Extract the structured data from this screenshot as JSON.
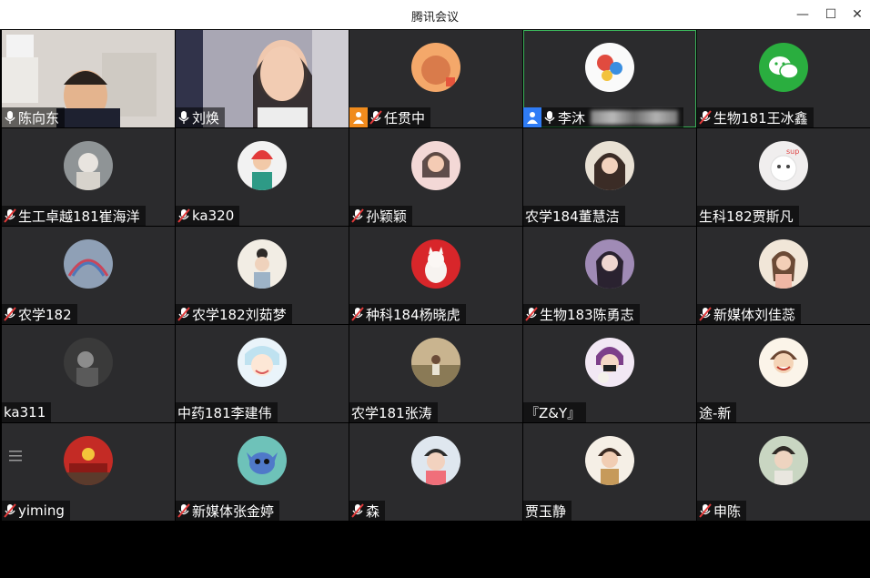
{
  "window": {
    "title": "腾讯会议",
    "minimize": "—",
    "maximize": "☐",
    "close": "✕"
  },
  "colors": {
    "tile_bg": "#2b2b2d",
    "active_border": "#3bb35a",
    "host_orange": "#f08b1d",
    "cohost_blue": "#2f7cf6"
  },
  "participants": [
    {
      "name": "陈向东",
      "mic": "on",
      "type": "video"
    },
    {
      "name": "刘焕",
      "mic": "on",
      "type": "video"
    },
    {
      "name": "任贯中",
      "mic": "muted",
      "type": "avatar",
      "role": "host"
    },
    {
      "name": "李沐",
      "mic": "on",
      "type": "avatar",
      "role": "cohost",
      "active": true
    },
    {
      "name": "生物181王冰鑫",
      "mic": "muted",
      "type": "avatar"
    },
    {
      "name": "生工卓越181崔海洋",
      "mic": "muted",
      "type": "avatar"
    },
    {
      "name": "ka320",
      "mic": "muted",
      "type": "avatar"
    },
    {
      "name": "孙颖颖",
      "mic": "muted",
      "type": "avatar"
    },
    {
      "name": "农学184董慧洁",
      "mic": "none",
      "type": "avatar"
    },
    {
      "name": "生科182贾斯凡",
      "mic": "none",
      "type": "avatar"
    },
    {
      "name": "农学182",
      "mic": "muted",
      "type": "avatar"
    },
    {
      "name": "农学182刘茹梦",
      "mic": "muted",
      "type": "avatar"
    },
    {
      "name": "种科184杨晓虎",
      "mic": "muted",
      "type": "avatar"
    },
    {
      "name": "生物183陈勇志",
      "mic": "muted",
      "type": "avatar"
    },
    {
      "name": "新媒体刘佳蕊",
      "mic": "muted",
      "type": "avatar"
    },
    {
      "name": "ka311",
      "mic": "none",
      "type": "avatar"
    },
    {
      "name": "中药181李建伟",
      "mic": "none",
      "type": "avatar"
    },
    {
      "name": "农学181张涛",
      "mic": "none",
      "type": "avatar"
    },
    {
      "name": "『Z&Y』",
      "mic": "none",
      "type": "avatar"
    },
    {
      "name": "途-新",
      "mic": "none",
      "type": "avatar"
    },
    {
      "name": "yiming",
      "mic": "muted",
      "type": "avatar"
    },
    {
      "name": "新媒体张金婷",
      "mic": "muted",
      "type": "avatar"
    },
    {
      "name": "森",
      "mic": "muted",
      "type": "avatar"
    },
    {
      "name": "贾玉静",
      "mic": "none",
      "type": "avatar"
    },
    {
      "name": "申陈",
      "mic": "muted",
      "type": "avatar"
    }
  ]
}
